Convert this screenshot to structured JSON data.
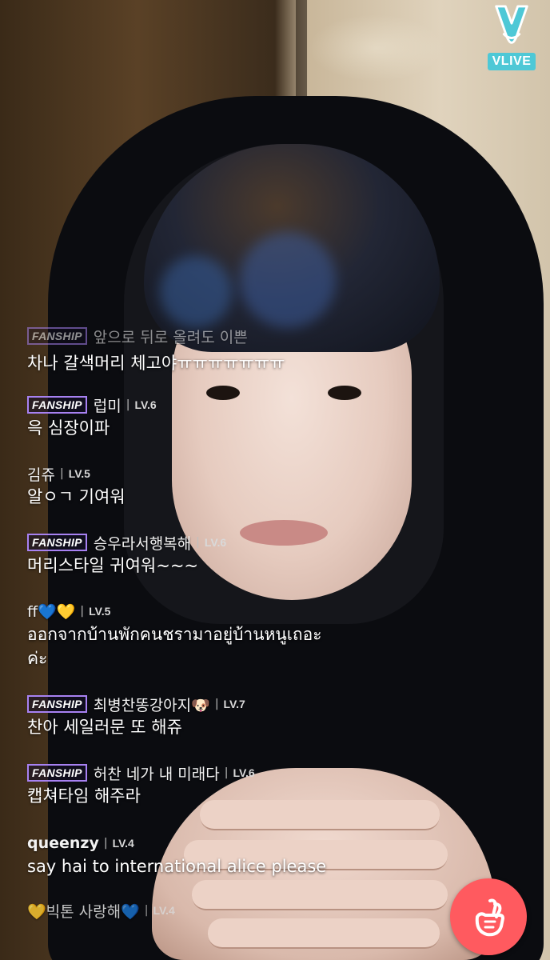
{
  "app": {
    "logo_text": "VLIVE",
    "accent": "#4ec8d6",
    "heart_color": "#ff5a5f",
    "fanship_color": "#a781f2"
  },
  "chat": {
    "cropped_top": {
      "badge": "FANSHIP",
      "user": "앞으로 뒤로 올려도 이쁜",
      "text": "차나 갈색머리 체고야ㅠㅠㅠㅠㅠㅠㅠ"
    },
    "messages": [
      {
        "badge": "FANSHIP",
        "user": "럽미",
        "level": "LV.6",
        "text": "윽 심장이파"
      },
      {
        "badge": "",
        "user": "김쥬",
        "level": "LV.5",
        "text": "알ㅇㄱ 기여워"
      },
      {
        "badge": "FANSHIP",
        "user": "승우라서행복해",
        "level": "LV.6",
        "text": "머리스타일 귀여워~~~"
      },
      {
        "badge": "",
        "user": "ff💙💛",
        "level": "LV.5",
        "text": "ออกจากบ้านพักคนชรามาอยู่บ้านหนูเถอะ",
        "text2": "ค่ะ"
      },
      {
        "badge": "FANSHIP",
        "user": "최병찬똥강아지🐶",
        "level": "LV.7",
        "text": "찬아 세일러문 또 해쥬"
      },
      {
        "badge": "FANSHIP",
        "user": "허찬 네가 내 미래다",
        "level": "LV.6",
        "text": "캡쳐타임 해주라"
      },
      {
        "badge": "",
        "user": "queenzy",
        "level": "LV.4",
        "text": "say hai to international alice please"
      },
      {
        "badge": "",
        "user": "💛빅톤 사랑해💙",
        "level": "LV.4",
        "text": ""
      }
    ]
  },
  "icons": {
    "logo": "vlive-v-logo",
    "heart_button": "finger-heart-icon"
  }
}
